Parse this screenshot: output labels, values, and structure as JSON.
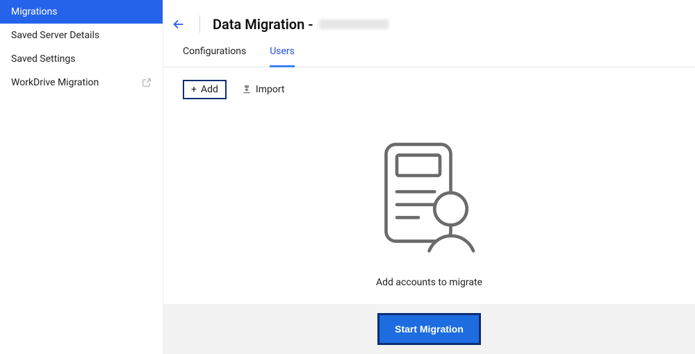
{
  "sidebar": {
    "items": [
      {
        "label": "Migrations",
        "active": true,
        "external": false
      },
      {
        "label": "Saved Server Details",
        "active": false,
        "external": false
      },
      {
        "label": "Saved Settings",
        "active": false,
        "external": false
      },
      {
        "label": "WorkDrive Migration",
        "active": false,
        "external": true
      }
    ]
  },
  "header": {
    "title_prefix": "Data Migration -"
  },
  "tabs": [
    {
      "label": "Configurations",
      "active": false
    },
    {
      "label": "Users",
      "active": true
    }
  ],
  "toolbar": {
    "add_label": "Add",
    "import_label": "Import"
  },
  "empty_state": {
    "message": "Add accounts to migrate"
  },
  "footer": {
    "start_label": "Start Migration"
  }
}
